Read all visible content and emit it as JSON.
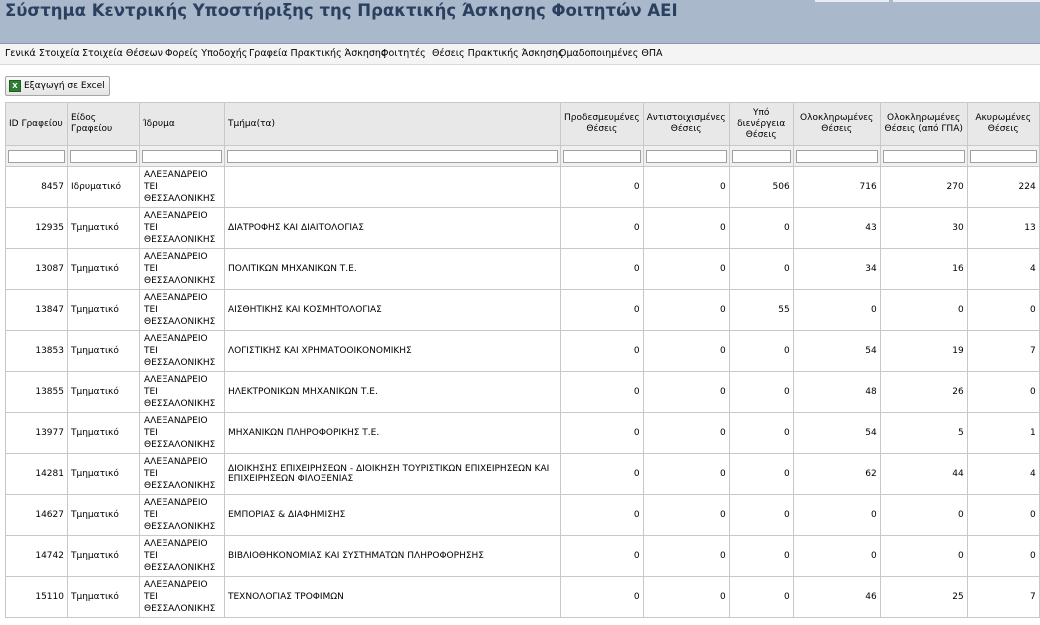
{
  "header": {
    "title": "Σύστημα Κεντρικής Υποστήριξης της Πρακτικής Άσκησης Φοιτητών ΑΕΙ"
  },
  "menu": [
    {
      "label": "Γενικά Στοιχεία"
    },
    {
      "label": "Στοιχεία Θέσεων"
    },
    {
      "label": "Φορείς Υποδοχής"
    },
    {
      "label": "Γραφεία Πρακτικής Άσκησης"
    },
    {
      "label": "Φοιτητές"
    },
    {
      "label": "Θέσεις Πρακτικής Άσκησης"
    },
    {
      "label": "Ομαδοποιημένες ΘΠΑ"
    }
  ],
  "toolbar": {
    "export_label": "Εξαγωγή σε Excel",
    "export_icon": "excel-icon"
  },
  "table": {
    "columns": [
      "ID Γραφείου",
      "Είδος Γραφείου",
      "Ίδρυμα",
      "Τμήμα(τα)",
      "Προδεσμευμένες Θέσεις",
      "Αντιστοιχισμένες Θέσεις",
      "Υπό διενέργεια Θέσεις",
      "Ολοκληρωμένες Θέσεις",
      "Ολοκληρωμένες Θέσεις (από ΓΠΑ)",
      "Ακυρωμένες Θέσεις"
    ],
    "institution_lines": [
      "ΑΛΕΞΑΝΔΡΕΙΟ",
      "ΤΕΙ",
      "ΘΕΣΣΑΛΟΝΙΚΗΣ"
    ],
    "rows": [
      {
        "id": "8457",
        "type": "Ιδρυματικό",
        "dept": "",
        "pre": "0",
        "matched": "0",
        "ongoing": "506",
        "done": "716",
        "done_gpa": "270",
        "cancelled": "224"
      },
      {
        "id": "12935",
        "type": "Τμηματικό",
        "dept": "ΔΙΑΤΡΟΦΗΣ ΚΑΙ ΔΙΑΙΤΟΛΟΓΙΑΣ",
        "pre": "0",
        "matched": "0",
        "ongoing": "0",
        "done": "43",
        "done_gpa": "30",
        "cancelled": "13"
      },
      {
        "id": "13087",
        "type": "Τμηματικό",
        "dept": "ΠΟΛΙΤΙΚΩΝ ΜΗΧΑΝΙΚΩΝ Τ.Ε.",
        "pre": "0",
        "matched": "0",
        "ongoing": "0",
        "done": "34",
        "done_gpa": "16",
        "cancelled": "4"
      },
      {
        "id": "13847",
        "type": "Τμηματικό",
        "dept": "ΑΙΣΘΗΤΙΚΗΣ ΚΑΙ ΚΟΣΜΗΤΟΛΟΓΙΑΣ",
        "pre": "0",
        "matched": "0",
        "ongoing": "55",
        "done": "0",
        "done_gpa": "0",
        "cancelled": "0"
      },
      {
        "id": "13853",
        "type": "Τμηματικό",
        "dept": "ΛΟΓΙΣΤΙΚΗΣ ΚΑΙ ΧΡΗΜΑΤΟΟΙΚΟΝΟΜΙΚΗΣ",
        "pre": "0",
        "matched": "0",
        "ongoing": "0",
        "done": "54",
        "done_gpa": "19",
        "cancelled": "7"
      },
      {
        "id": "13855",
        "type": "Τμηματικό",
        "dept": "ΗΛΕΚΤΡΟΝΙΚΩΝ ΜΗΧΑΝΙΚΩΝ Τ.Ε.",
        "pre": "0",
        "matched": "0",
        "ongoing": "0",
        "done": "48",
        "done_gpa": "26",
        "cancelled": "0"
      },
      {
        "id": "13977",
        "type": "Τμηματικό",
        "dept": "ΜΗΧΑΝΙΚΩΝ ΠΛΗΡΟΦΟΡΙΚΗΣ Τ.Ε.",
        "pre": "0",
        "matched": "0",
        "ongoing": "0",
        "done": "54",
        "done_gpa": "5",
        "cancelled": "1"
      },
      {
        "id": "14281",
        "type": "Τμηματικό",
        "dept": "ΔΙΟΙΚΗΣΗΣ ΕΠΙΧΕΙΡΗΣΕΩΝ - ΔΙΟΙΚΗΣΗ ΤΟΥΡΙΣΤΙΚΩΝ ΕΠΙΧΕΙΡΗΣΕΩΝ ΚΑΙ ΕΠΙΧΕΙΡΗΣΕΩΝ ΦΙΛΟΞΕΝΙΑΣ",
        "pre": "0",
        "matched": "0",
        "ongoing": "0",
        "done": "62",
        "done_gpa": "44",
        "cancelled": "4"
      },
      {
        "id": "14627",
        "type": "Τμηματικό",
        "dept": "ΕΜΠΟΡΙΑΣ & ΔΙΑΦΗΜΙΣΗΣ",
        "pre": "0",
        "matched": "0",
        "ongoing": "0",
        "done": "0",
        "done_gpa": "0",
        "cancelled": "0"
      },
      {
        "id": "14742",
        "type": "Τμηματικό",
        "dept": "ΒΙΒΛΙΟΘΗΚΟΝΟΜΙΑΣ ΚΑΙ ΣΥΣΤΗΜΑΤΩΝ ΠΛΗΡΟΦΟΡΗΣΗΣ",
        "pre": "0",
        "matched": "0",
        "ongoing": "0",
        "done": "0",
        "done_gpa": "0",
        "cancelled": "0"
      },
      {
        "id": "15110",
        "type": "Τμηματικό",
        "dept": "ΤΕΧΝΟΛΟΓΙΑΣ ΤΡΟΦΙΜΩΝ",
        "pre": "0",
        "matched": "0",
        "ongoing": "0",
        "done": "46",
        "done_gpa": "25",
        "cancelled": "7"
      }
    ]
  }
}
